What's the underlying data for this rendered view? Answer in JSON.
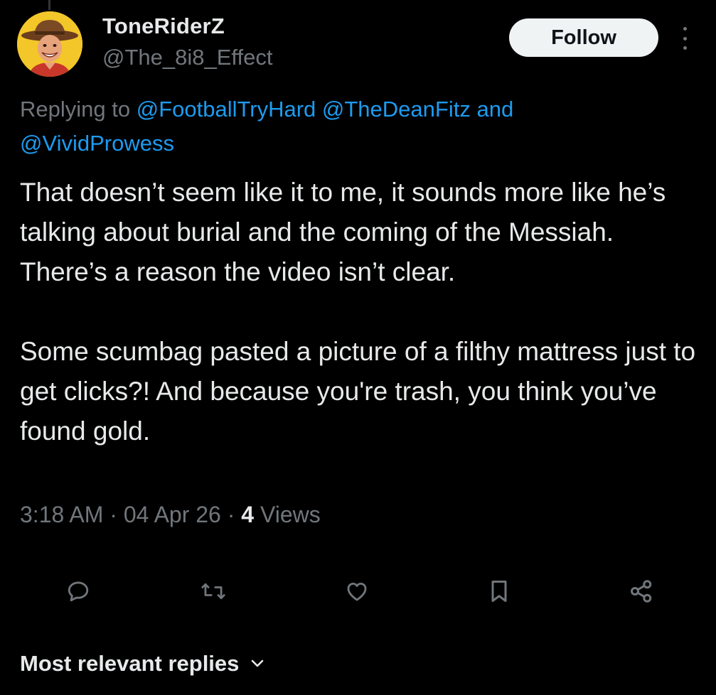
{
  "author": {
    "display_name": "ToneRiderZ",
    "handle": "@The_8i8_Effect",
    "avatar_icon": "cowboy-avatar",
    "avatar_bg": "#f3c62a"
  },
  "follow_label": "Follow",
  "more_icon": "more-vertical-icon",
  "reply_context": {
    "prefix": "Replying to",
    "mentions": [
      "@FootballTryHard",
      "@TheDeanFitz",
      "@VividProwess"
    ],
    "joiner": "and"
  },
  "tweet": {
    "lines": [
      "That doesn’t seem like it to me, it sounds more like he’s talking about burial and the coming of the Messiah.",
      "There’s a reason the video isn’t clear.",
      "",
      "Some scumbag pasted a picture of a filthy mattress just to get clicks?! And because you're trash, you think you’ve found gold."
    ]
  },
  "meta": {
    "time": "3:18 AM",
    "separator": "·",
    "date": "04 Apr 26",
    "views_count": "4",
    "views_label": "Views"
  },
  "actions": [
    "reply-icon",
    "retweet-icon",
    "like-icon",
    "bookmark-icon",
    "share-icon"
  ],
  "replies_sort": {
    "label": "Most relevant replies",
    "icon": "chevron-down-icon"
  },
  "colors": {
    "background": "#000000",
    "text": "#e7e9ea",
    "secondary": "#71767b",
    "link": "#1d9bf0",
    "button_bg": "#eff3f4"
  }
}
